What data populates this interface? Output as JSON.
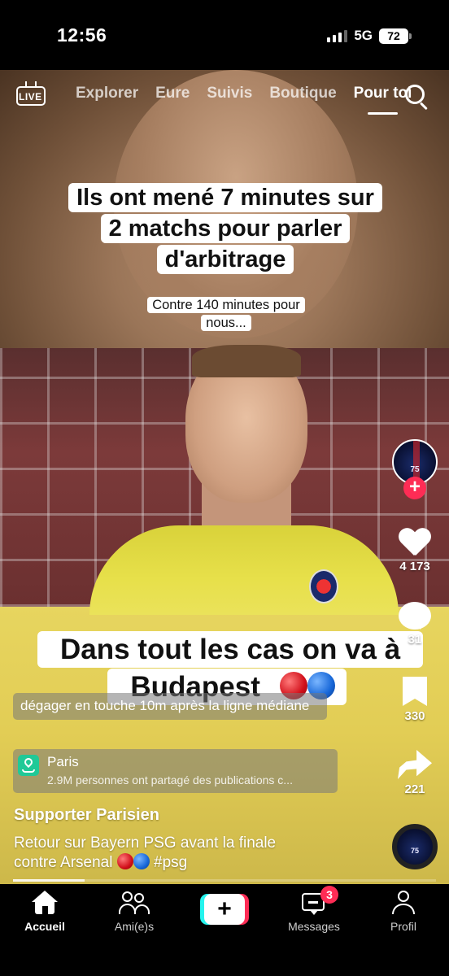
{
  "status_bar": {
    "time": "12:56",
    "network": "5G",
    "battery": "72"
  },
  "top_nav": {
    "live_label": "LIVE",
    "tabs": [
      {
        "label": "Explorer"
      },
      {
        "label": "Eure"
      },
      {
        "label": "Suivis"
      },
      {
        "label": "Boutique"
      },
      {
        "label": "Pour toi",
        "active": true
      }
    ]
  },
  "video": {
    "caption_main": "Ils ont mené 7 minutes sur 2 matchs pour parler d'arbitrage",
    "caption_sub": "Contre 140 minutes pour nous...",
    "caption_big": "Dans tout les cas on va à Budapest",
    "info_text": "dégager en touche 10m après la ligne médiane",
    "progress": 0.17
  },
  "creator": {
    "avatar_number": "75"
  },
  "actions": {
    "likes": "4 173",
    "comments": "31",
    "bookmarks": "330",
    "shares": "221"
  },
  "location": {
    "name": "Paris",
    "description": "2.9M personnes ont partagé des publications c..."
  },
  "post": {
    "author": "Supporter Parisien",
    "description_line1": "Retour sur Bayern PSG avant la finale",
    "description_line2_prefix": "contre Arsenal",
    "hashtag": "#psg"
  },
  "bottom_nav": {
    "home": "Accueil",
    "friends": "Ami(e)s",
    "create": "+",
    "messages": "Messages",
    "messages_badge": "3",
    "profile": "Profil"
  },
  "colors": {
    "accent_red": "#fe2c55",
    "accent_cyan": "#25f4ee",
    "location_green": "#20c997"
  }
}
